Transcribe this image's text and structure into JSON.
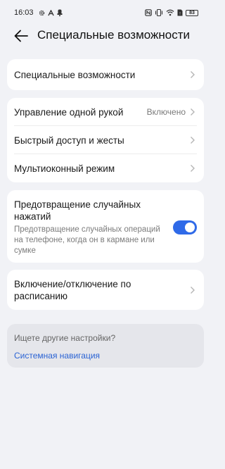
{
  "status_bar": {
    "time": "16:03",
    "left_icons": [
      "gear-icon",
      "font-icon",
      "notification-icon"
    ],
    "right_icons": [
      "nfc-icon",
      "vibrate-icon",
      "wifi-icon",
      "sim-icon"
    ],
    "battery": "83"
  },
  "header": {
    "title": "Специальные возможности"
  },
  "group1": {
    "items": [
      {
        "label": "Специальные возможности"
      }
    ]
  },
  "group2": {
    "items": [
      {
        "label": "Управление одной рукой",
        "value": "Включено"
      },
      {
        "label": "Быстрый доступ и жесты"
      },
      {
        "label": "Мультиоконный режим"
      }
    ]
  },
  "group3": {
    "title": "Предотвращение случайных нажатий",
    "description": "Предотвращение случайных операций на телефоне, когда он в кармане или сумке",
    "toggle_on": true
  },
  "group4": {
    "label": "Включение/отключение по расписанию"
  },
  "suggest": {
    "title": "Ищете другие настройки?",
    "link": "Системная навигация"
  },
  "colors": {
    "accent": "#2f6ae8",
    "link": "#2a63d4",
    "background": "#f1f2f6"
  }
}
